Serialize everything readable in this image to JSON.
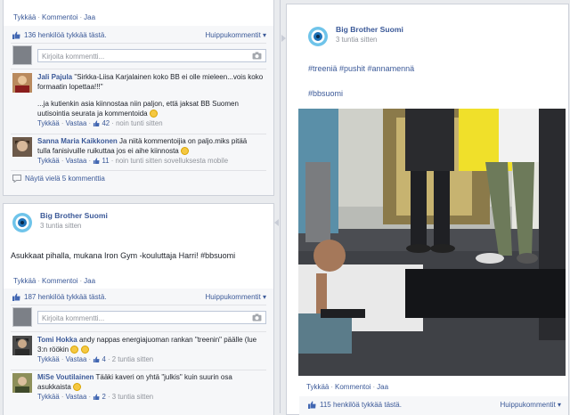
{
  "left_top": {
    "actions": [
      "Tykkää",
      "Kommentoi",
      "Jaa"
    ],
    "likes": "136 henkilöä tykkää tästä.",
    "top_comments": "Huippukommentit",
    "comment_placeholder": "Kirjoita kommentti...",
    "comments": [
      {
        "name": "Jali Pajula",
        "text": "\"Sirkka-Liisa Karjalainen koko BB ei olle mieleen...vois koko formaatin lopettaa!!!\"",
        "text2": "...ja kutienkin asia kiinnostaa niin paljon, että jaksat BB Suomen uutisointia seurata ja kommentoida",
        "like": "Tykkää",
        "reply": "Vastaa",
        "count": "42",
        "time": "noin tunti sitten",
        "via": ""
      },
      {
        "name": "Sanna Maria Kaikkonen",
        "text": "Ja niitä kommentoijia on paljo.miks pitää tulla fanisivuille ruikuttaa jos ei aihe kiinnosta",
        "like": "Tykkää",
        "reply": "Vastaa",
        "count": "11",
        "time": "noin tunti sitten",
        "via": "sovelluksesta mobile"
      }
    ],
    "more": "Näytä vielä 5 kommenttia"
  },
  "left_post": {
    "page_name": "Big Brother Suomi",
    "time": "3 tuntia sitten",
    "text": "Asukkaat pihalla, mukana Iron Gym -kouluttaja Harri! #bbsuomi",
    "actions": [
      "Tykkää",
      "Kommentoi",
      "Jaa"
    ],
    "likes": "187 henkilöä tykkää tästä.",
    "top_comments": "Huippukommentit",
    "comment_placeholder": "Kirjoita kommentti...",
    "comments": [
      {
        "name": "Tomi Hokka",
        "text": "andy nappas energiajuoman rankan \"treenin\" päälle (lue 3:n röökin",
        "like": "Tykkää",
        "reply": "Vastaa",
        "count": "4",
        "time": "2 tuntia sitten"
      },
      {
        "name": "MiSe Voutilainen",
        "text": "Tääki kaveri on yhtä \"julkis\" kuin suurin osa asukkaista",
        "like": "Tykkää",
        "reply": "Vastaa",
        "count": "2",
        "time": "3 tuntia sitten"
      }
    ]
  },
  "right_post": {
    "page_name": "Big Brother Suomi",
    "time": "3 tuntia sitten",
    "hashtags1": "#treeniä #pushit #annamennä",
    "hashtags2": "#bbsuomi",
    "actions": [
      "Tykkää",
      "Kommentoi",
      "Jaa"
    ],
    "likes": "115 henkilöä tykkää tästä.",
    "top_comments": "Huippukommentit"
  },
  "icons": {
    "thumb": "thumbs-up-icon",
    "camera": "camera-icon",
    "smile": "smile-emoticon",
    "logo": "big-brother-eye-logo"
  },
  "colors": {
    "link": "#3b5998",
    "meta": "#90949c",
    "ufi_bg": "#f6f7f9"
  }
}
